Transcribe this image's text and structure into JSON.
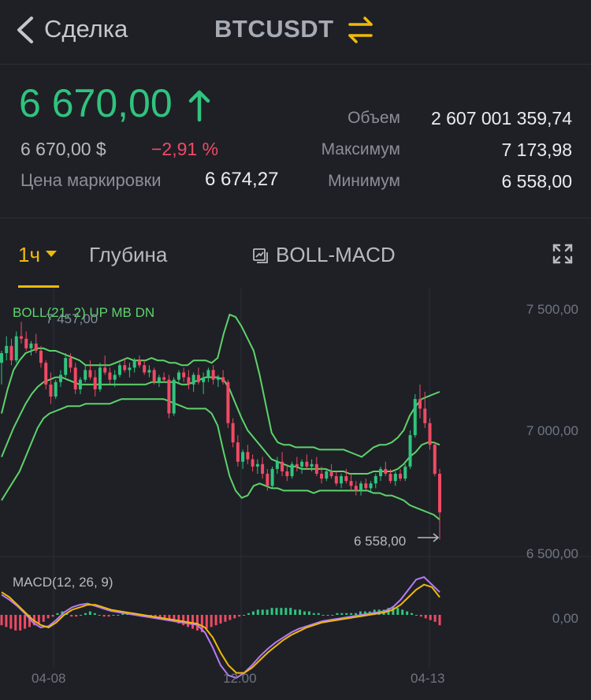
{
  "header": {
    "back_label": "Сделка",
    "title": "BTCUSDT"
  },
  "ticker": {
    "last_price": "6 670,00",
    "last_price_usd": "6 670,00 $",
    "change_pct": "−2,91 %",
    "mark_label": "Цена маркировки",
    "mark_value": "6 674,27",
    "volume_label": "Объем",
    "volume_value": "2 607 001 359,74",
    "high_label": "Максимум",
    "high_value": "7 173,98",
    "low_label": "Минимум",
    "low_value": "6 558,00"
  },
  "tabs": {
    "interval": "1ч",
    "depth": "Глубина",
    "indicator": "BOLL-MACD"
  },
  "colors": {
    "up": "#30c47e",
    "down": "#f04a64",
    "accent": "#f0b90b",
    "boll": "#5ed36a",
    "macd_line": "#f0b90b",
    "signal_line": "#b67bf2"
  },
  "chart_data": {
    "type": "candlestick",
    "legend_boll": "BOLL(21, 2) UP MB DN",
    "legend_value": "7 457,00",
    "legend_macd": "MACD(12, 26, 9)",
    "price_axis": [
      "7 500,00",
      "7 000,00",
      "6 500,00"
    ],
    "macd_axis": "0,00",
    "time_axis": [
      "04-08",
      "12:00",
      "04-13"
    ],
    "low_marker": "6 558,00",
    "ylim": [
      6500,
      7500
    ],
    "candles": [
      [
        7290,
        7340,
        7200,
        7330
      ],
      [
        7330,
        7400,
        7300,
        7360
      ],
      [
        7360,
        7390,
        7280,
        7300
      ],
      [
        7300,
        7420,
        7290,
        7400
      ],
      [
        7400,
        7460,
        7370,
        7390
      ],
      [
        7390,
        7420,
        7340,
        7350
      ],
      [
        7350,
        7380,
        7320,
        7370
      ],
      [
        7370,
        7410,
        7330,
        7340
      ],
      [
        7340,
        7360,
        7270,
        7290
      ],
      [
        7290,
        7300,
        7180,
        7200
      ],
      [
        7200,
        7250,
        7120,
        7150
      ],
      [
        7150,
        7220,
        7140,
        7210
      ],
      [
        7210,
        7260,
        7190,
        7240
      ],
      [
        7240,
        7330,
        7230,
        7310
      ],
      [
        7310,
        7330,
        7250,
        7270
      ],
      [
        7270,
        7290,
        7160,
        7180
      ],
      [
        7180,
        7230,
        7160,
        7220
      ],
      [
        7220,
        7280,
        7210,
        7260
      ],
      [
        7260,
        7300,
        7220,
        7230
      ],
      [
        7230,
        7260,
        7150,
        7180
      ],
      [
        7180,
        7290,
        7170,
        7270
      ],
      [
        7270,
        7320,
        7240,
        7250
      ],
      [
        7250,
        7270,
        7200,
        7220
      ],
      [
        7220,
        7260,
        7190,
        7240
      ],
      [
        7240,
        7290,
        7230,
        7280
      ],
      [
        7280,
        7310,
        7250,
        7260
      ],
      [
        7260,
        7290,
        7230,
        7270
      ],
      [
        7270,
        7310,
        7250,
        7300
      ],
      [
        7300,
        7320,
        7270,
        7280
      ],
      [
        7280,
        7300,
        7240,
        7250
      ],
      [
        7250,
        7280,
        7230,
        7260
      ],
      [
        7260,
        7270,
        7200,
        7210
      ],
      [
        7210,
        7240,
        7190,
        7230
      ],
      [
        7230,
        7250,
        7210,
        7220
      ],
      [
        7220,
        7240,
        7060,
        7080
      ],
      [
        7080,
        7230,
        7070,
        7220
      ],
      [
        7220,
        7260,
        7200,
        7250
      ],
      [
        7250,
        7270,
        7210,
        7230
      ],
      [
        7230,
        7260,
        7180,
        7200
      ],
      [
        7200,
        7250,
        7170,
        7240
      ],
      [
        7240,
        7270,
        7200,
        7210
      ],
      [
        7210,
        7250,
        7160,
        7230
      ],
      [
        7230,
        7270,
        7210,
        7260
      ],
      [
        7260,
        7280,
        7200,
        7220
      ],
      [
        7220,
        7240,
        7190,
        7230
      ],
      [
        7230,
        7260,
        7200,
        7210
      ],
      [
        7210,
        7220,
        7020,
        7040
      ],
      [
        7040,
        7060,
        6940,
        6960
      ],
      [
        6960,
        6990,
        6860,
        6880
      ],
      [
        6880,
        6930,
        6850,
        6920
      ],
      [
        6920,
        6950,
        6870,
        6890
      ],
      [
        6890,
        6910,
        6840,
        6860
      ],
      [
        6860,
        6890,
        6830,
        6870
      ],
      [
        6870,
        6900,
        6810,
        6830
      ],
      [
        6830,
        6850,
        6760,
        6780
      ],
      [
        6780,
        6860,
        6770,
        6850
      ],
      [
        6850,
        6900,
        6830,
        6880
      ],
      [
        6880,
        6920,
        6820,
        6840
      ],
      [
        6840,
        6870,
        6800,
        6820
      ],
      [
        6820,
        6880,
        6810,
        6870
      ],
      [
        6870,
        6900,
        6840,
        6860
      ],
      [
        6860,
        6890,
        6830,
        6880
      ],
      [
        6880,
        6910,
        6850,
        6860
      ],
      [
        6860,
        6890,
        6840,
        6870
      ],
      [
        6870,
        6900,
        6820,
        6830
      ],
      [
        6830,
        6860,
        6790,
        6810
      ],
      [
        6810,
        6850,
        6800,
        6840
      ],
      [
        6840,
        6870,
        6810,
        6820
      ],
      [
        6820,
        6840,
        6780,
        6790
      ],
      [
        6790,
        6830,
        6770,
        6820
      ],
      [
        6820,
        6850,
        6790,
        6800
      ],
      [
        6800,
        6830,
        6760,
        6780
      ],
      [
        6780,
        6800,
        6740,
        6760
      ],
      [
        6760,
        6800,
        6740,
        6790
      ],
      [
        6790,
        6810,
        6760,
        6770
      ],
      [
        6770,
        6800,
        6750,
        6790
      ],
      [
        6790,
        6830,
        6770,
        6820
      ],
      [
        6820,
        6860,
        6800,
        6850
      ],
      [
        6850,
        6880,
        6820,
        6830
      ],
      [
        6830,
        6850,
        6790,
        6800
      ],
      [
        6800,
        6840,
        6780,
        6830
      ],
      [
        6830,
        6850,
        6800,
        6810
      ],
      [
        6810,
        6870,
        6800,
        6860
      ],
      [
        6860,
        7010,
        6850,
        6990
      ],
      [
        6990,
        7160,
        6980,
        7140
      ],
      [
        7140,
        7200,
        7060,
        7100
      ],
      [
        7100,
        7170,
        7020,
        7040
      ],
      [
        7040,
        7060,
        6930,
        6950
      ],
      [
        6950,
        6960,
        6820,
        6830
      ],
      [
        6830,
        6850,
        6558,
        6670
      ]
    ],
    "boll_up": [
      7080,
      7180,
      7260,
      7300,
      7330,
      7340,
      7350,
      7350,
      7340,
      7340,
      7330,
      7320,
      7310,
      7300,
      7280,
      7280,
      7280,
      7280,
      7280,
      7290,
      7300,
      7310,
      7300,
      7300,
      7300,
      7310,
      7300,
      7300,
      7290,
      7290,
      7280,
      7280,
      7300,
      7300,
      7300,
      7290,
      7310,
      7410,
      7490,
      7480,
      7440,
      7390,
      7340,
      7240,
      7120,
      7000,
      6960,
      6950,
      6950,
      6940,
      6940,
      6940,
      6940,
      6930,
      6930,
      6930,
      6930,
      6930,
      6920,
      6910,
      6900,
      6920,
      6940,
      6950,
      6950,
      6960,
      6980,
      7010,
      7070,
      7110,
      7140,
      7150,
      7160,
      7170
    ],
    "boll_mb": [
      6900,
      6960,
      7020,
      7070,
      7120,
      7160,
      7190,
      7210,
      7220,
      7230,
      7230,
      7220,
      7210,
      7200,
      7200,
      7200,
      7200,
      7200,
      7200,
      7200,
      7200,
      7200,
      7200,
      7200,
      7200,
      7210,
      7210,
      7210,
      7210,
      7210,
      7200,
      7200,
      7210,
      7220,
      7230,
      7230,
      7230,
      7220,
      7180,
      7120,
      7060,
      7010,
      6980,
      6950,
      6920,
      6890,
      6880,
      6870,
      6860,
      6860,
      6850,
      6850,
      6850,
      6850,
      6850,
      6840,
      6840,
      6840,
      6830,
      6830,
      6830,
      6830,
      6840,
      6840,
      6840,
      6840,
      6850,
      6870,
      6900,
      6920,
      6950,
      6960,
      6960,
      6950
    ],
    "boll_dn": [
      6720,
      6760,
      6800,
      6840,
      6900,
      6960,
      7020,
      7060,
      7080,
      7090,
      7100,
      7110,
      7110,
      7110,
      7120,
      7120,
      7120,
      7120,
      7120,
      7130,
      7140,
      7140,
      7140,
      7140,
      7140,
      7140,
      7140,
      7140,
      7130,
      7120,
      7110,
      7100,
      7100,
      7100,
      7100,
      7080,
      7030,
      6920,
      6820,
      6760,
      6730,
      6740,
      6780,
      6790,
      6780,
      6770,
      6770,
      6760,
      6760,
      6760,
      6760,
      6760,
      6750,
      6760,
      6760,
      6760,
      6760,
      6760,
      6760,
      6760,
      6760,
      6760,
      6750,
      6750,
      6740,
      6740,
      6730,
      6720,
      6700,
      6690,
      6680,
      6670,
      6660,
      6640
    ],
    "macd_hist": [
      -6,
      -7,
      -8,
      -9,
      -9,
      -8,
      -7,
      -6,
      -5,
      -4,
      -2,
      -1,
      1,
      2,
      1,
      -1,
      -1,
      0,
      1,
      2,
      1,
      0,
      -1,
      -1,
      0,
      0,
      1,
      1,
      1,
      0,
      0,
      -1,
      -1,
      -1,
      -2,
      -3,
      -3,
      -4,
      -5,
      -6,
      -7,
      -8,
      -9,
      -10,
      -8,
      -7,
      -6,
      -5,
      -4,
      -3,
      -2,
      -1,
      0,
      1,
      2,
      3,
      3,
      3,
      4,
      4,
      4,
      4,
      4,
      3,
      3,
      2,
      2,
      1,
      1,
      0,
      0,
      0,
      1,
      1,
      1,
      1,
      1,
      2,
      2,
      2,
      3,
      3,
      3,
      4,
      5,
      4,
      3,
      2,
      1,
      0,
      -1,
      -2,
      -3,
      -4,
      -6
    ],
    "macd_line": [
      18,
      14,
      8,
      2,
      -4,
      -8,
      -10,
      -6,
      0,
      4,
      6,
      8,
      8,
      6,
      4,
      3,
      2,
      1,
      0,
      -1,
      -2,
      -3,
      -4,
      -5,
      -6,
      -7,
      -10,
      -18,
      -30,
      -40,
      -46,
      -46,
      -42,
      -36,
      -30,
      -25,
      -20,
      -16,
      -13,
      -10,
      -8,
      -6,
      -5,
      -4,
      -3,
      -2,
      -1,
      0,
      1,
      2,
      4,
      8,
      14,
      20,
      24,
      22,
      14
    ],
    "signal_line": [
      16,
      12,
      7,
      1,
      -6,
      -10,
      -9,
      -4,
      2,
      6,
      8,
      9,
      7,
      5,
      3,
      2,
      1,
      0,
      -1,
      -2,
      -3,
      -4,
      -5,
      -6,
      -7,
      -8,
      -14,
      -26,
      -40,
      -48,
      -50,
      -46,
      -40,
      -33,
      -27,
      -22,
      -18,
      -14,
      -11,
      -9,
      -7,
      -5,
      -4,
      -3,
      -2,
      -1,
      0,
      1,
      2,
      3,
      6,
      12,
      20,
      28,
      30,
      24,
      18
    ]
  }
}
